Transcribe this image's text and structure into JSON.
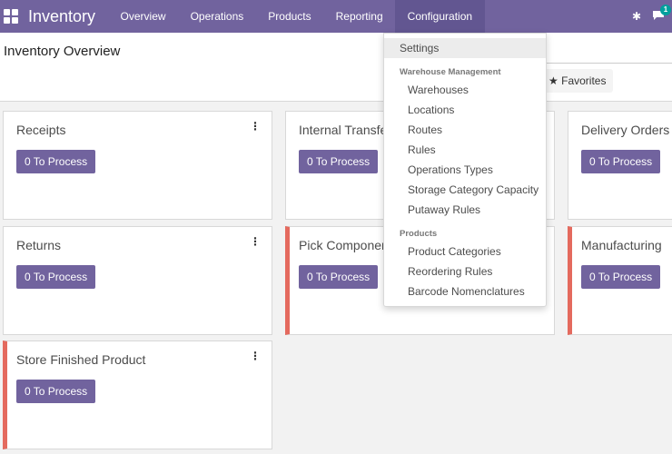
{
  "navbar": {
    "brand": "Inventory",
    "menu": [
      "Overview",
      "Operations",
      "Products",
      "Reporting",
      "Configuration"
    ],
    "chat_count": "1",
    "apps_icon": "grid-icon",
    "debug_icon": "bug-icon",
    "chat_icon": "chat-icon"
  },
  "control_panel": {
    "title": "Inventory Overview",
    "favorites_label": "Favorites"
  },
  "cards": [
    {
      "title": "Receipts",
      "button": "0 To Process"
    },
    {
      "title": "Internal Transfers",
      "button": "0 To Process"
    },
    {
      "title": "Delivery Orders",
      "button": "0 To Process"
    },
    {
      "title": "Returns",
      "button": "0 To Process"
    },
    {
      "title": "Pick Components",
      "button": "0 To Process"
    },
    {
      "title": "Manufacturing",
      "button": "0 To Process"
    },
    {
      "title": "Store Finished Product",
      "button": "0 To Process"
    }
  ],
  "dropdown": {
    "settings": "Settings",
    "warehouse_header": "Warehouse Management",
    "warehouse_items": [
      "Warehouses",
      "Locations",
      "Routes",
      "Rules",
      "Operations Types",
      "Storage Category Capacity",
      "Putaway Rules"
    ],
    "products_header": "Products",
    "products_items": [
      "Product Categories",
      "Reordering Rules",
      "Barcode Nomenclatures"
    ]
  },
  "colors": {
    "brand": "#71639e",
    "alert": "#e46a5e",
    "badge": "#00a09d"
  }
}
